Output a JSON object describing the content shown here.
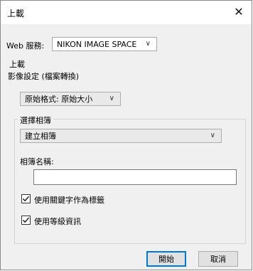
{
  "window": {
    "title": "上載"
  },
  "web_service": {
    "label": "Web 服務:",
    "value": "NIKON IMAGE SPACE"
  },
  "upload_group": {
    "label": "上載"
  },
  "image_settings": {
    "label": "影像設定 (檔案轉換)",
    "value": "原始格式: 原始大小"
  },
  "album_group": {
    "label": "選擇相簿",
    "album_select_value": "建立相簿",
    "album_name_label": "相簿名稱:",
    "album_name_value": ""
  },
  "options": {
    "use_keywords": {
      "label": "使用關鍵字作為標籤",
      "checked": true
    },
    "use_rating": {
      "label": "使用等級資訊",
      "checked": true
    }
  },
  "buttons": {
    "start": "開始",
    "cancel": "取消"
  }
}
